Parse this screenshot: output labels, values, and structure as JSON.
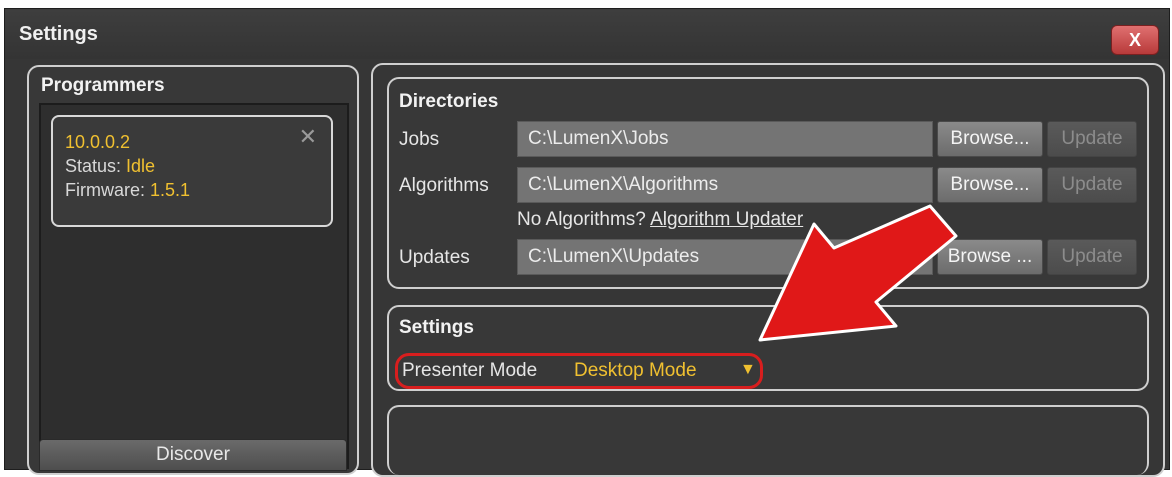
{
  "window": {
    "title": "Settings",
    "close_label": "X"
  },
  "programmers": {
    "title": "Programmers",
    "items": [
      {
        "ip": "10.0.0.2",
        "status_label": "Status:",
        "status": "Idle",
        "firmware_label": "Firmware:",
        "firmware": "1.5.1"
      }
    ],
    "remove_glyph": "✕",
    "discover_label": "Discover"
  },
  "directories": {
    "title": "Directories",
    "rows": [
      {
        "label": "Jobs",
        "path": "C:\\LumenX\\Jobs",
        "browse": "Browse...",
        "update": "Update"
      },
      {
        "label": "Algorithms",
        "path": "C:\\LumenX\\Algorithms",
        "browse": "Browse...",
        "update": "Update"
      },
      {
        "label": "Updates",
        "path": "C:\\LumenX\\Updates",
        "browse": "Browse ...",
        "update": "Update"
      }
    ],
    "no_algorithms_text": "No Algorithms?",
    "algorithm_updater_link": "Algorithm Updater"
  },
  "settings": {
    "title": "Settings",
    "presenter_label": "Presenter Mode",
    "presenter_value": "Desktop Mode",
    "dropdown_glyph": "▼"
  },
  "colors": {
    "accent_yellow": "#f0c030",
    "highlight_red": "#d81e1e"
  }
}
